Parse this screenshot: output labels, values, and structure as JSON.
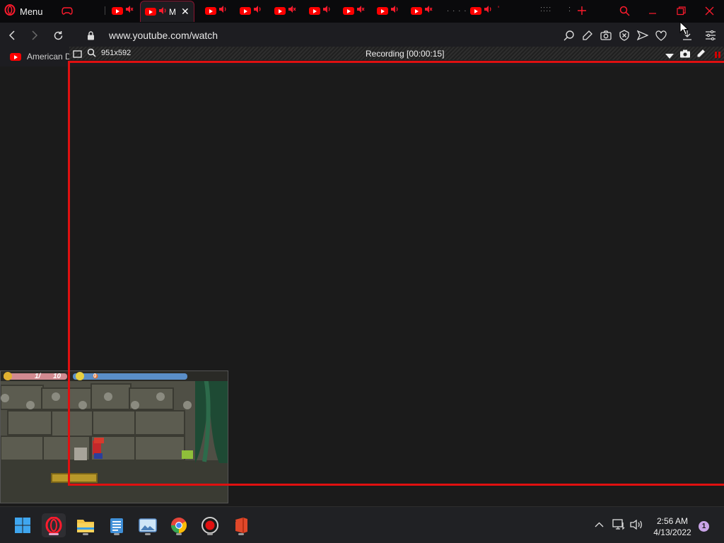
{
  "browser": {
    "menu_label": "Menu",
    "active_tab_title": "M",
    "url": "www.youtube.com/watch",
    "bookmark_label": "American D",
    "tab_extra_1": ". . . .",
    "tab_extra_2": "::::",
    "tab_extra_3": ":",
    "tab_extra_4": "'"
  },
  "recorder": {
    "dimensions": "951x592",
    "status": "Recording [00:00:15]"
  },
  "game_hud": {
    "fp": "1/",
    "hp": "10",
    "sp": "0"
  },
  "taskbar": {
    "time": "2:56 AM",
    "date": "4/13/2022",
    "notification_count": "1"
  },
  "colors": {
    "accent": "#ff1b2d",
    "recording_frame": "#e01010",
    "youtube_red": "#ff0000"
  }
}
